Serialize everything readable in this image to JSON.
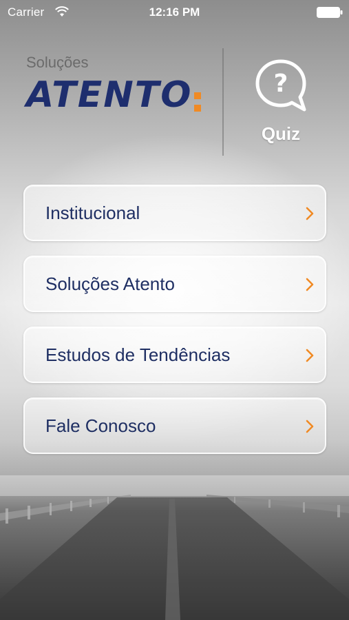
{
  "status_bar": {
    "carrier": "Carrier",
    "time": "12:16 PM"
  },
  "logo": {
    "subtitle": "Soluções",
    "wordmark": "ATENTO"
  },
  "quiz": {
    "label": "Quiz",
    "icon": "question-bubble-icon"
  },
  "menu": {
    "items": [
      {
        "label": "Institucional"
      },
      {
        "label": "Soluções Atento"
      },
      {
        "label": "Estudos de Tendências"
      },
      {
        "label": "Fale Conosco"
      }
    ]
  },
  "colors": {
    "brand_blue": "#1e2e6e",
    "accent_orange": "#f08a24",
    "text_blue": "#1f2f63"
  }
}
